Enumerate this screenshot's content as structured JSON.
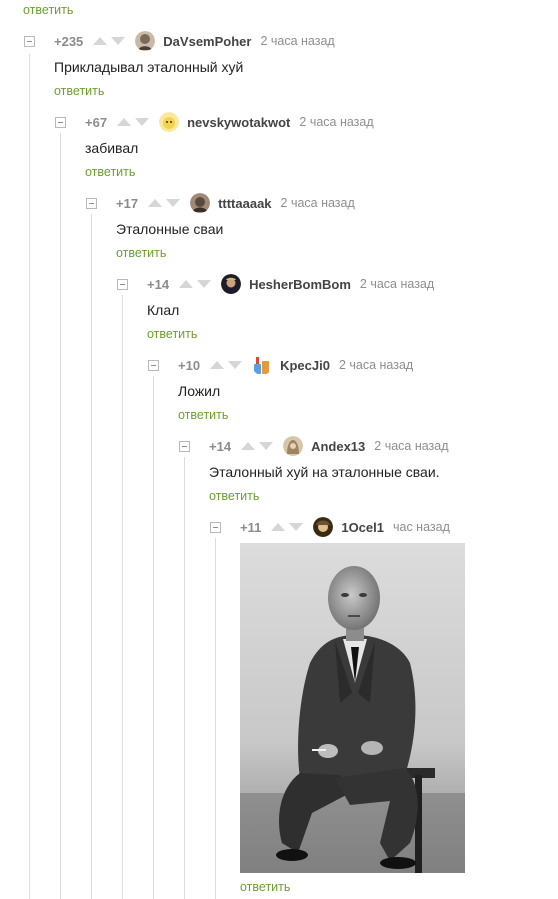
{
  "reply_label": "ответить",
  "comments": [
    {
      "rating": "+235",
      "author": "DaVsemPoher",
      "time": "2 часа назад",
      "text": "Прикладывал эталонный хуй",
      "avatar_color": "#7a6a5c"
    },
    {
      "rating": "+67",
      "author": "nevskywotakwot",
      "time": "2 часа назад",
      "text": "забивал",
      "avatar_color": "#f4d24a"
    },
    {
      "rating": "+17",
      "author": "ttttaaaak",
      "time": "2 часа назад",
      "text": "Эталонные сваи",
      "avatar_color": "#5a4a3e"
    },
    {
      "rating": "+14",
      "author": "HesherBomBom",
      "time": "2 часа назад",
      "text": "Клал",
      "avatar_color": "#1c1c2a"
    },
    {
      "rating": "+10",
      "author": "KpecJi0",
      "time": "2 часа назад",
      "text": "Ложил",
      "avatar_color": "#e9973a"
    },
    {
      "rating": "+14",
      "author": "Andex13",
      "time": "2 часа назад",
      "text": "Эталонный хуй на эталонные сваи.",
      "avatar_color": "#9d8464"
    },
    {
      "rating": "+11",
      "author": "1Ocel1",
      "time": "час назад",
      "text": "",
      "avatar_color": "#6a5330"
    }
  ],
  "colors": {
    "reply_link": "#6e9e32",
    "rating": "#8c8c8c",
    "vote_arrow": "#d6d6d6",
    "thread_line": "#dcdcdc"
  }
}
